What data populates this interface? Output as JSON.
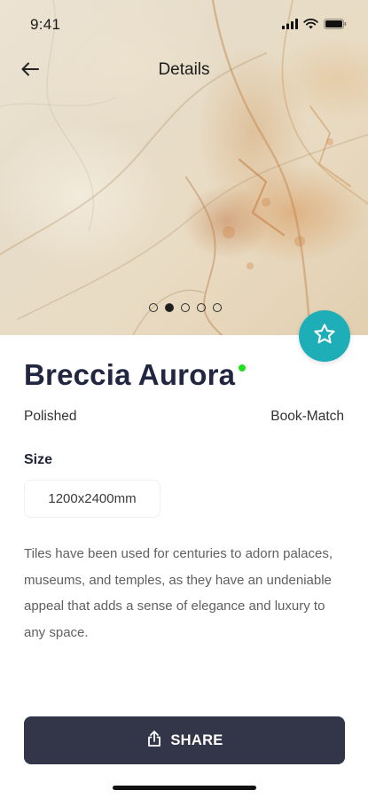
{
  "status_bar": {
    "time": "9:41",
    "icons": [
      "cellular-signal-icon",
      "wifi-icon",
      "battery-icon"
    ]
  },
  "nav": {
    "back_icon": "arrow-left-icon",
    "title": "Details"
  },
  "gallery": {
    "image": "breccia-aurora-marble",
    "total_slides": 5,
    "active_index": 1
  },
  "favorite": {
    "icon": "star-outline-icon",
    "color": "#1eaeb8"
  },
  "product": {
    "name": "Breccia Aurora",
    "availability_color": "#1de31d",
    "finish": "Polished",
    "pattern": "Book-Match",
    "size_label": "Size",
    "size_value": "1200x2400mm",
    "description": "Tiles have been used for centuries to adorn palaces, museums, and temples, as they have an undeniable appeal that adds a sense of elegance and luxury to any space."
  },
  "actions": {
    "share_label": "SHARE",
    "share_icon": "share-upload-icon",
    "button_color": "#333548"
  }
}
